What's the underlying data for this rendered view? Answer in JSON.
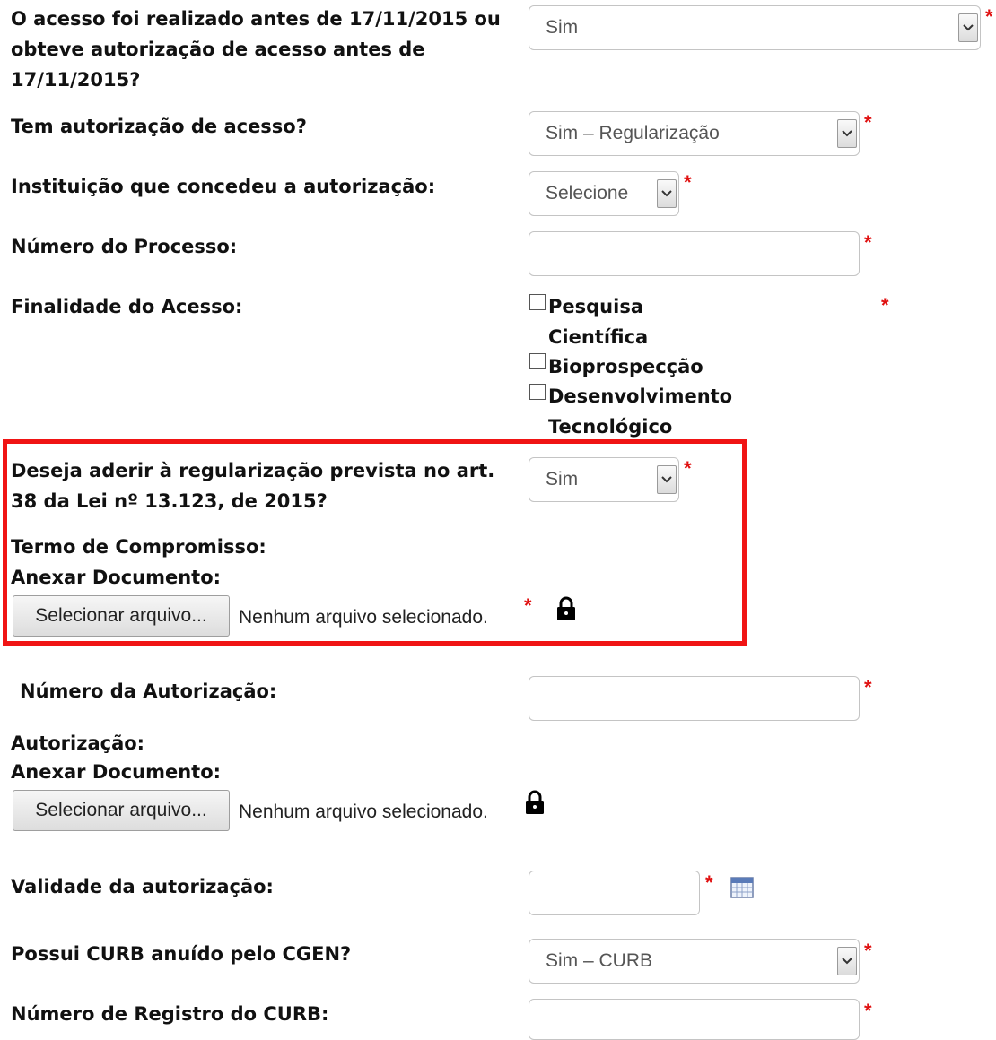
{
  "q_acesso": {
    "label_lines": [
      "O acesso foi realizado antes de 17/11/2015 ou",
      "obteve autorização de acesso antes de",
      "17/11/2015?"
    ],
    "value": "Sim",
    "required": "*"
  },
  "q_autorizacao": {
    "label": "Tem autorização de acesso?",
    "value": "Sim – Regularização",
    "required": "*"
  },
  "q_instituicao": {
    "label": "Instituição que concedeu a autorização:",
    "value": "Selecione",
    "required": "*"
  },
  "q_processo": {
    "label": "Número do Processo:",
    "value": "",
    "required": "*"
  },
  "q_finalidade": {
    "label": "Finalidade do Acesso:",
    "required": "*",
    "options": [
      {
        "lines": [
          "Pesquisa",
          "Científica"
        ],
        "checked": false
      },
      {
        "lines": [
          "Bioprospecção"
        ],
        "checked": false
      },
      {
        "lines": [
          "Desenvolvimento",
          "Tecnológico"
        ],
        "checked": false
      }
    ]
  },
  "q_aderir": {
    "label_lines": [
      "Deseja aderir à regularização prevista no art.",
      "38 da Lei nº 13.123, de 2015?"
    ],
    "value": "Sim",
    "required": "*"
  },
  "termo": {
    "title": "Termo de Compromisso:",
    "attach_label": "Anexar Documento:",
    "button": "Selecionar arquivo...",
    "status": "Nenhum arquivo selecionado.",
    "required": "*"
  },
  "q_num_autorizacao": {
    "label": "Número da Autorização:",
    "value": "",
    "required": "*"
  },
  "autorizacao_doc": {
    "title": "Autorização:",
    "attach_label": "Anexar Documento:",
    "button": "Selecionar arquivo...",
    "status": "Nenhum arquivo selecionado."
  },
  "q_validade": {
    "label": "Validade da autorização:",
    "value": "",
    "required": "*"
  },
  "q_curb": {
    "label": "Possui CURB anuído pelo CGEN?",
    "value": "Sim – CURB",
    "required": "*"
  },
  "q_registro_curb": {
    "label": "Número de Registro do CURB:",
    "value": "",
    "required": "*"
  },
  "icons": {
    "lock": "lock-icon",
    "calendar": "calendar-icon",
    "dropdown": "chevron-down-icon"
  },
  "colors": {
    "required": "#e01010",
    "highlight_box": "#f01414"
  }
}
